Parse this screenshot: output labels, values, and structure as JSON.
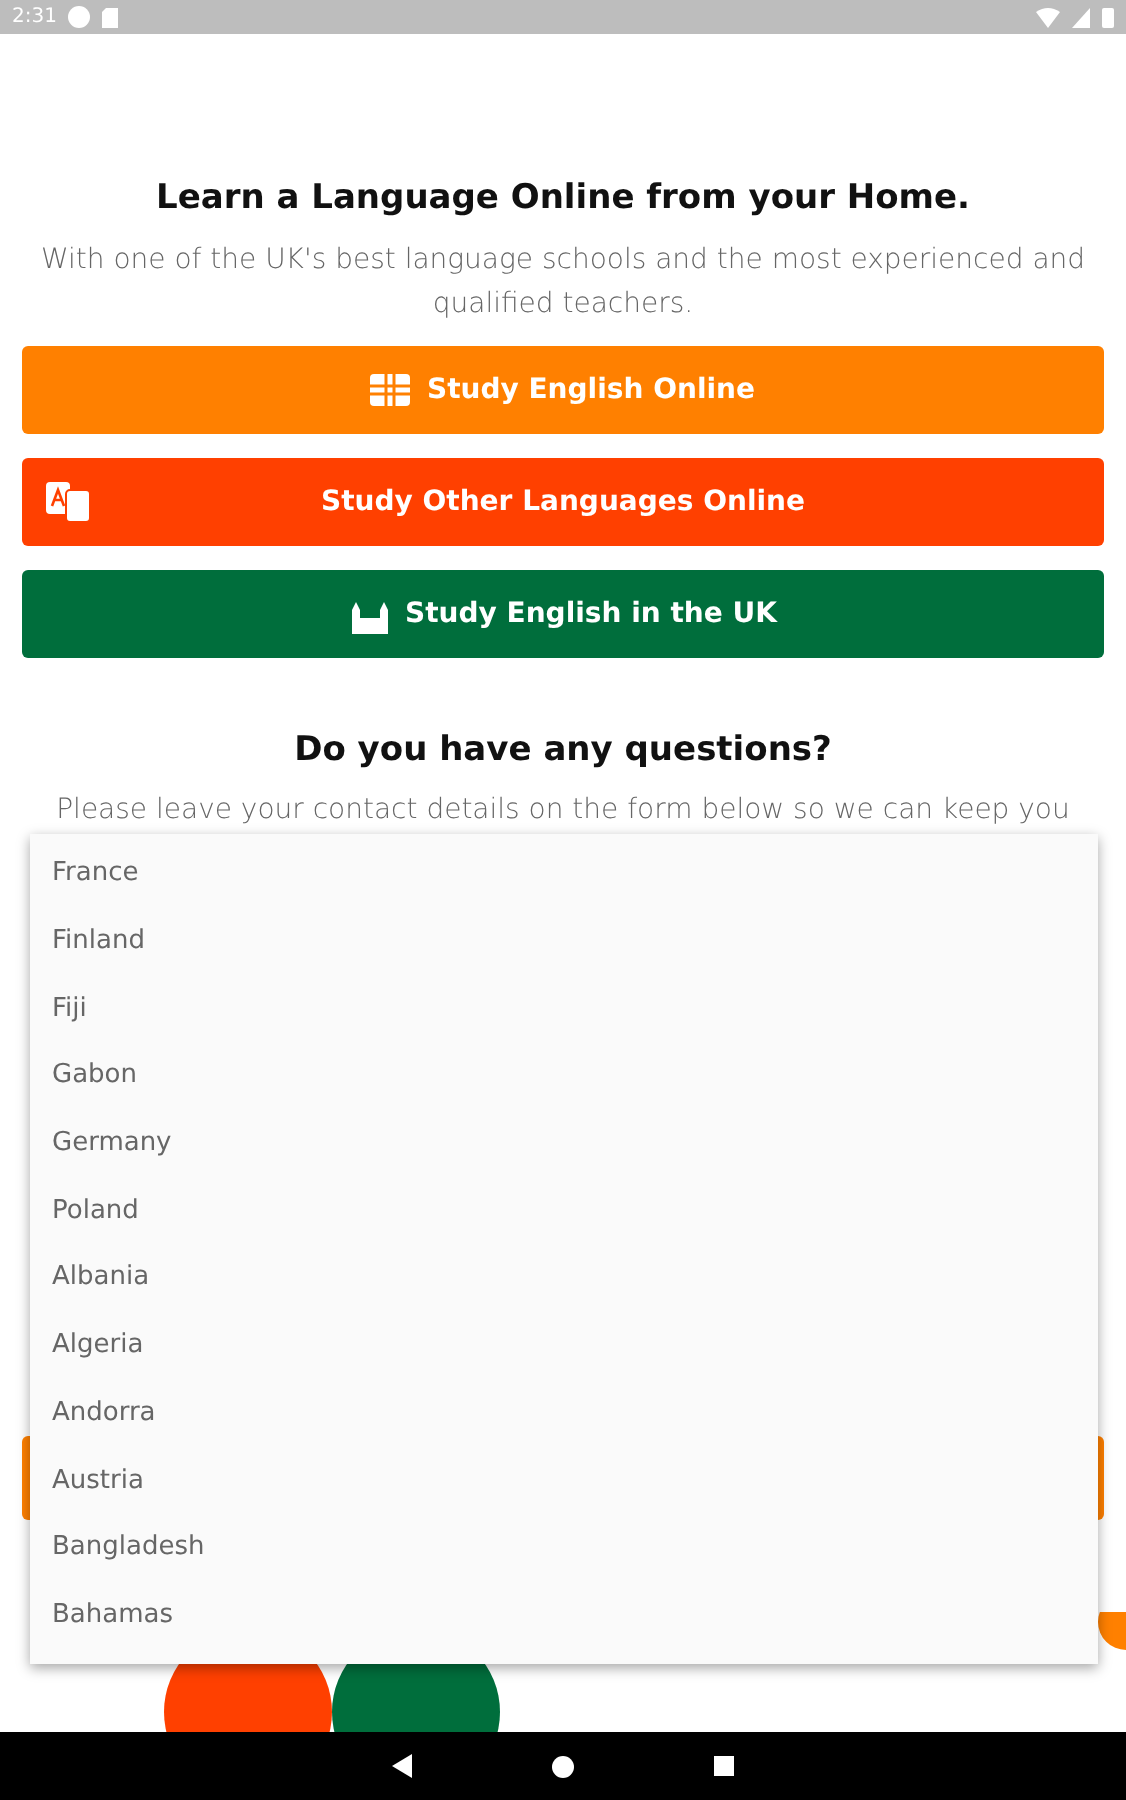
{
  "status_bar": {
    "time": "2:31"
  },
  "hero": {
    "title": "Learn a Language Online from your Home.",
    "subtitle": "With one of the UK's best language schools and the most experienced and qualified teachers."
  },
  "buttons": [
    {
      "label": "Study English Online",
      "kind": "flag",
      "color": "#ff8000"
    },
    {
      "label": "Study Other Languages Online",
      "kind": "translate",
      "color": "#ff4000"
    },
    {
      "label": "Study English in the UK",
      "kind": "landmark",
      "color": "#006e3c"
    }
  ],
  "questions": {
    "title": "Do you have any questions?",
    "text": "Please leave your contact details on the form below so we can keep you"
  },
  "dropdown": {
    "options": [
      "France",
      "Finland",
      "Fiji",
      "Gabon",
      "Germany",
      "Poland",
      "Albania",
      "Algeria",
      "Andorra",
      "Austria",
      "Bangladesh",
      "Bahamas"
    ]
  }
}
